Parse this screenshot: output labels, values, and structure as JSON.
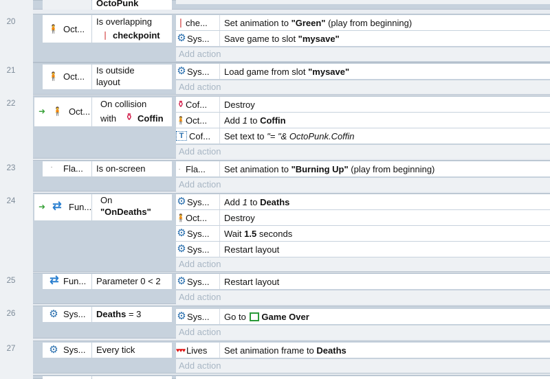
{
  "top": {
    "label": "OctoPunk"
  },
  "events": [
    {
      "num": "20",
      "obj": "Oct...",
      "cond": "Is overlapping",
      "cond2": "checkpoint",
      "actions": [
        {
          "obj": "che...",
          "pre": "Set animation to ",
          "bold": "\"Green\"",
          "post": " (play from beginning)"
        },
        {
          "obj": "Sys...",
          "pre": "Save game to slot ",
          "bold": "\"mysave\"",
          "post": ""
        }
      ]
    },
    {
      "num": "21",
      "obj": "Oct...",
      "cond": "Is outside",
      "cond2": "layout",
      "actions": [
        {
          "obj": "Sys...",
          "pre": "Load game from slot ",
          "bold": "\"mysave\"",
          "post": ""
        }
      ]
    },
    {
      "num": "22",
      "obj": "Oct...",
      "cond": "On collision",
      "cond2a": "with",
      "cond2": "Coffin",
      "actions": [
        {
          "obj": "Cof...",
          "pre": "Destroy",
          "bold": "",
          "post": ""
        },
        {
          "obj": "Oct...",
          "pre": "Add ",
          "ital": "1",
          "pre2": " to ",
          "bold": "Coffin",
          "post": ""
        },
        {
          "obj": "Cof...",
          "pre": "Set text to ",
          "ital": "\"= \"& OctoPunk.Coffin",
          "bold": "",
          "post": ""
        }
      ]
    },
    {
      "num": "23",
      "obj": "Fla...",
      "cond": "Is on-screen",
      "actions": [
        {
          "obj": "Fla...",
          "pre": "Set animation to ",
          "bold": "\"Burning Up\"",
          "post": " (play from beginning)"
        }
      ]
    },
    {
      "num": "24",
      "obj": "Fun...",
      "cond": "On",
      "cond2": "\"OnDeaths\"",
      "actions": [
        {
          "obj": "Sys...",
          "pre": "Add ",
          "ital": "1",
          "pre2": " to ",
          "bold": "Deaths",
          "post": ""
        },
        {
          "obj": "Oct...",
          "pre": "Destroy",
          "bold": "",
          "post": ""
        },
        {
          "obj": "Sys...",
          "pre": "Wait ",
          "bold": "1.5",
          "post": " seconds"
        },
        {
          "obj": "Sys...",
          "pre": "Restart layout",
          "bold": "",
          "post": ""
        }
      ]
    },
    {
      "num": "25",
      "obj": "Fun...",
      "cond": "Parameter 0 < 2",
      "actions": [
        {
          "obj": "Sys...",
          "pre": "Restart layout",
          "bold": "",
          "post": ""
        }
      ]
    },
    {
      "num": "26",
      "obj": "Sys...",
      "condb": "Deaths",
      "cond": " = 3",
      "actions": [
        {
          "obj": "Sys...",
          "pre": "Go to ",
          "bold": "Game Over",
          "post": ""
        }
      ]
    },
    {
      "num": "27",
      "obj": "Sys...",
      "cond": "Every tick",
      "actions": [
        {
          "obj": "Lives",
          "pre": "Set animation frame to ",
          "bold": "Deaths",
          "post": ""
        }
      ]
    }
  ],
  "add_action": "Add action",
  "colors": {
    "gear": "#2a6fae",
    "loop": "#2a7fd0",
    "arrow": "#3aa23a",
    "lives": "#d11"
  }
}
